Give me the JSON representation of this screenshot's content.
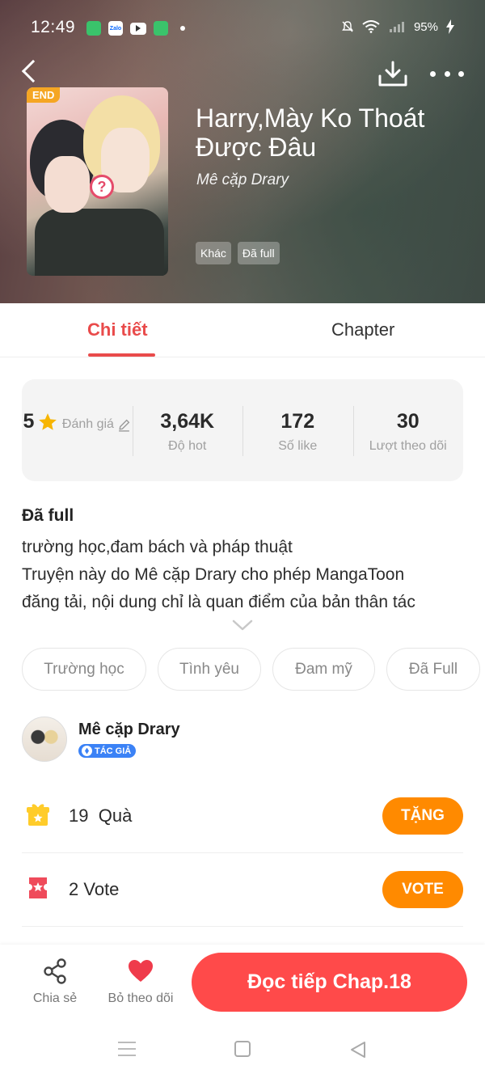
{
  "status_bar": {
    "time": "12:49",
    "apps": [
      "Zalo"
    ],
    "battery": "95%"
  },
  "header": {
    "back_icon": "chevron-left-icon",
    "download_icon": "download-icon",
    "more_icon": "more-dots-icon"
  },
  "manga": {
    "end_badge": "END",
    "title": "Harry,Mày Ko Thoát Được Đâu",
    "author": "Mê cặp Drary",
    "tags": [
      "Khác",
      "Đã full"
    ]
  },
  "tabs": [
    {
      "label": "Chi tiết",
      "active": true
    },
    {
      "label": "Chapter",
      "active": false
    }
  ],
  "stats": [
    {
      "value": "5",
      "label": "Đánh giá"
    },
    {
      "value": "3,64K",
      "label": "Độ hot"
    },
    {
      "value": "172",
      "label": "Số like"
    },
    {
      "value": "30",
      "label": "Lượt theo dõi"
    }
  ],
  "description": {
    "status": "Đã full",
    "lines": [
      "trường học,đam bách và pháp thuật",
      "Truyện này do Mê cặp Drary cho phép MangaToon",
      "đăng tải, nội dung chỉ là quan điểm của bản thân tác"
    ]
  },
  "genres": [
    "Trường học",
    "Tình yêu",
    "Đam mỹ",
    "Đã Full"
  ],
  "author_card": {
    "name": "Mê cặp Drary",
    "badge": "TÁC GIẢ"
  },
  "actions": {
    "gift": {
      "count": "19",
      "label": "Quà",
      "button": "TẶNG"
    },
    "vote": {
      "count": "2",
      "label": "Vote",
      "button": "VOTE"
    }
  },
  "bottom_bar": {
    "share": "Chia sẻ",
    "unfollow": "Bỏ theo dõi",
    "read": "Đọc tiếp Chap.18"
  },
  "colors": {
    "accent": "#e94b4b",
    "orange": "#ff8a00",
    "read_button": "#ff4a4a"
  }
}
